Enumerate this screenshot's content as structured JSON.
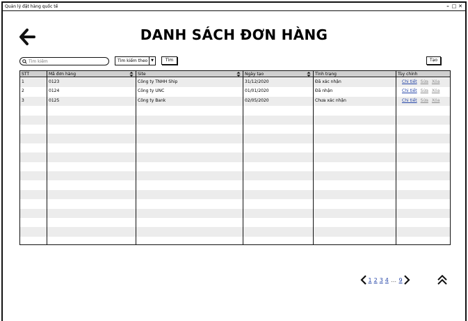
{
  "window": {
    "title": "Quản lý đặt hàng quốc tế",
    "controls": [
      "minimize-icon",
      "maximize-icon",
      "close-icon"
    ]
  },
  "page": {
    "title": "DANH SÁCH ĐƠN HÀNG",
    "back_icon": "back-arrow-icon"
  },
  "toolbar": {
    "search_placeholder": "Tìm kiếm",
    "search_icon": "search-icon",
    "filter_select_label": "Tìm kiếm theo",
    "search_button": "Tìm",
    "create_button": "Tạo"
  },
  "table": {
    "columns": [
      {
        "label": "STT",
        "sortable": false
      },
      {
        "label": "Mã đơn hàng",
        "sortable": true
      },
      {
        "label": "Site",
        "sortable": true
      },
      {
        "label": "Ngày tạo",
        "sortable": true
      },
      {
        "label": "Tình trạng",
        "sortable": false
      },
      {
        "label": "Tùy chỉnh",
        "sortable": false
      }
    ],
    "rows": [
      {
        "stt": "1",
        "code": "0123",
        "site": "Công ty TNHH Ship",
        "date": "31/12/2020",
        "status": "Đã xác nhận",
        "actions": [
          "Chi tiết",
          "Sửa",
          "Xóa"
        ]
      },
      {
        "stt": "2",
        "code": "0124",
        "site": "Công ty UNC",
        "date": "01/01/2020",
        "status": "Đã nhận",
        "actions": [
          "Chi tiết",
          "Sửa",
          "Xóa"
        ]
      },
      {
        "stt": "3",
        "code": "0125",
        "site": "Công ty Bank",
        "date": "02/05/2020",
        "status": "Chưa xác nhận",
        "actions": [
          "Chi tiết",
          "Sửa",
          "Xóa"
        ]
      }
    ],
    "header_bg": "#cfcfcf",
    "stripe_bg": "#ececec"
  },
  "pagination": {
    "prev_icon": "chevron-left-icon",
    "next_icon": "chevron-right-icon",
    "pages": [
      "1",
      "2",
      "3",
      "4"
    ],
    "ellipsis": "...",
    "last_page": "9",
    "link_color": "#2646a8"
  },
  "scroll_top_icon": "double-chevron-up-icon"
}
